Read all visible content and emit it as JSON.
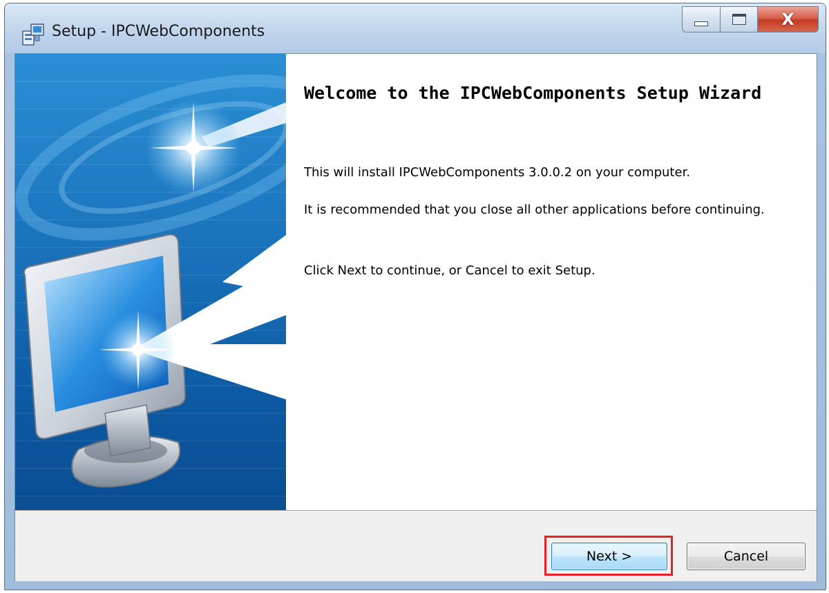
{
  "window": {
    "title": "Setup - IPCWebComponents",
    "app_icon": "setup-installer-icon",
    "caption_buttons": {
      "minimize": "minimize-icon",
      "maximize": "maximize-icon",
      "close_label": "X"
    }
  },
  "wizard": {
    "welcome_title": "Welcome to the IPCWebComponents Setup Wizard",
    "install_text": "This will install IPCWebComponents 3.0.0.2 on your computer.",
    "recommend_text": "It is recommended that you close all other applications before continuing.",
    "instruction_text": "Click Next to continue, or Cancel to exit Setup.",
    "banner_image": "monitor-with-arrow-illustration"
  },
  "footer": {
    "next_label": "Next >",
    "cancel_label": "Cancel",
    "highlighted_button": "next"
  },
  "colors": {
    "highlight": "#e8202a",
    "banner_blue": "#1f7fc4",
    "titlebar": "#c4d8ee"
  }
}
